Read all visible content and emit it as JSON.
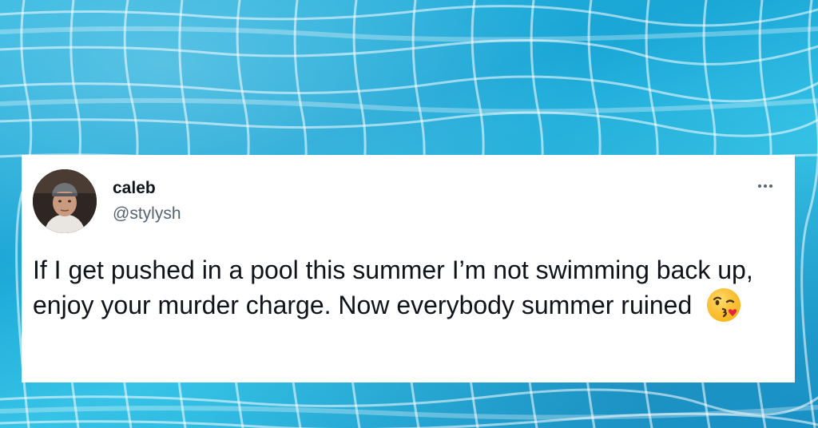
{
  "tweet": {
    "display_name": "caleb",
    "handle": "@stylysh",
    "text": "If I get pushed in a pool this summer I’m not swimming back up, enjoy your murder charge. Now everybody summer ruined",
    "emoji": "face-blowing-a-kiss"
  },
  "icons": {
    "more": "more-options-icon",
    "emoji": "kissing-face-with-heart-icon"
  },
  "colors": {
    "pool": "#1fa9d8",
    "card": "#ffffff",
    "text": "#0f1419",
    "muted": "#536471"
  }
}
